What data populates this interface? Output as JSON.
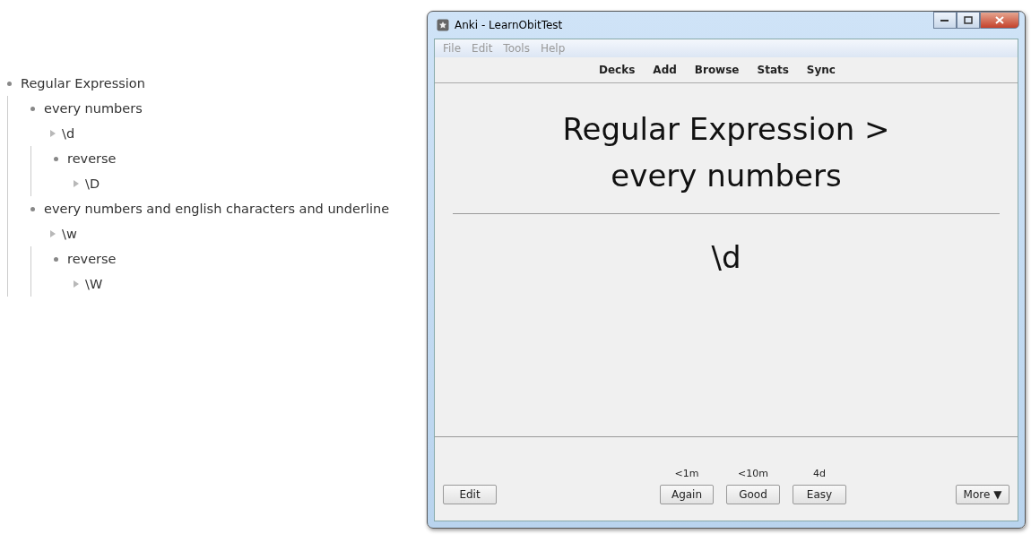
{
  "outline": [
    {
      "text": "Regular Expression",
      "children": [
        {
          "text": "every numbers",
          "note": "\\d",
          "children": [
            {
              "text": "reverse",
              "note": "\\D"
            }
          ]
        },
        {
          "text": "every numbers and english characters and underline",
          "note": "\\w",
          "children": [
            {
              "text": "reverse",
              "note": "\\W"
            }
          ]
        }
      ]
    }
  ],
  "window": {
    "title": "Anki - LearnObitTest",
    "menu": [
      "File",
      "Edit",
      "Tools",
      "Help"
    ],
    "toolbar": [
      "Decks",
      "Add",
      "Browse",
      "Stats",
      "Sync"
    ],
    "question": [
      "Regular Expression >",
      "every numbers"
    ],
    "answer": "\\d",
    "edit_button": "Edit",
    "answers": [
      {
        "interval": "<1m",
        "label": "Again"
      },
      {
        "interval": "<10m",
        "label": "Good"
      },
      {
        "interval": "4d",
        "label": "Easy"
      }
    ],
    "more_button": "More ▼"
  }
}
